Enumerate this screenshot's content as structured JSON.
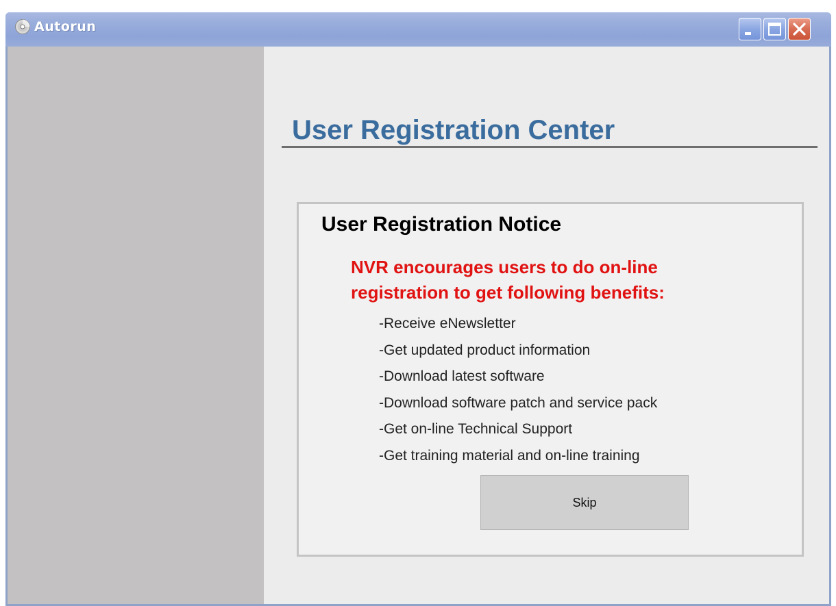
{
  "window": {
    "title": "Autorun",
    "title_icon": "cd-disc-icon",
    "controls": {
      "minimize": "minimize-icon",
      "maximize": "maximize-icon",
      "close": "close-icon"
    }
  },
  "main": {
    "heading": "User Registration Center"
  },
  "notice": {
    "title": "User Registration Notice",
    "lead_line1": "NVR encourages users to do on-line",
    "lead_line2": "registration to get following benefits:",
    "benefits": [
      "-Receive eNewsletter",
      "-Get updated product information",
      "-Download latest software",
      "-Download software patch and service pack",
      "-Get on-line Technical Support",
      "-Get training material and on-line training"
    ],
    "skip_label": "Skip"
  },
  "colors": {
    "heading": "#3a6c9e",
    "lead": "#e11212",
    "sidebar": "#c3c1c2",
    "titlebar": "#9aaedc"
  }
}
